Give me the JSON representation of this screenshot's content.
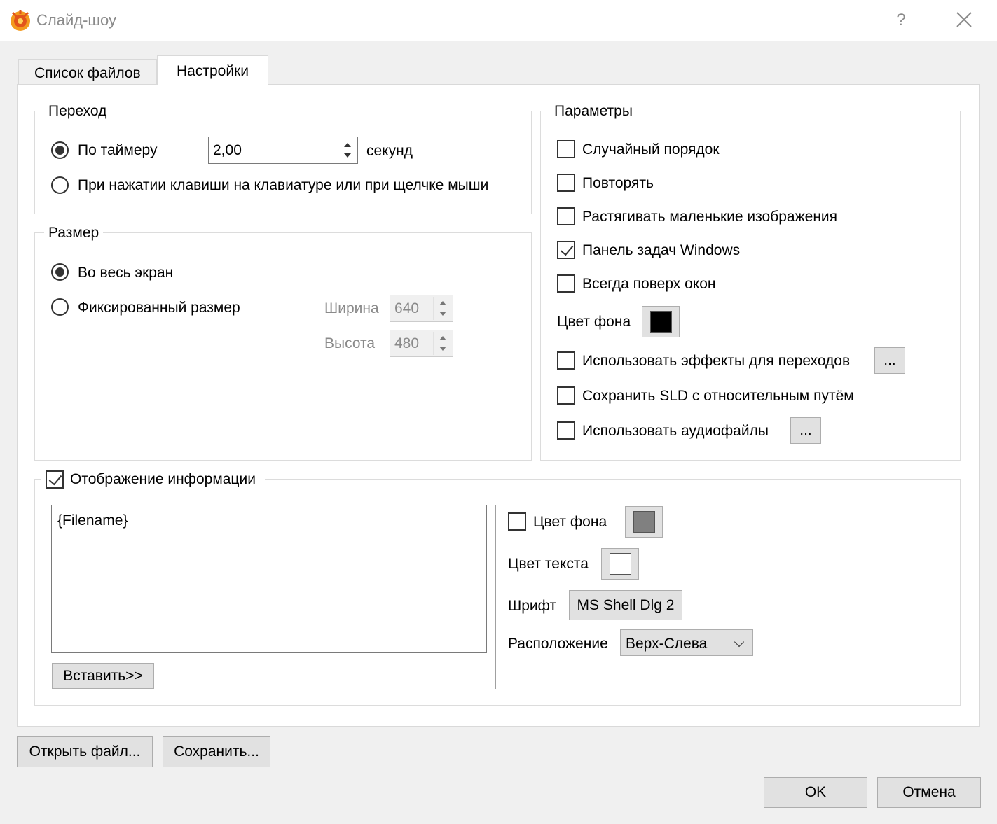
{
  "window": {
    "title": "Слайд-шоу",
    "help_label": "?",
    "icon": "xnview-app-icon"
  },
  "tabs": [
    {
      "label": "Список файлов",
      "active": false
    },
    {
      "label": "Настройки",
      "active": true
    }
  ],
  "transition": {
    "legend": "Переход",
    "timer_label": "По таймеру",
    "timer_selected": true,
    "timer_value": "2,00",
    "timer_unit": "секунд",
    "key_label": "При нажатии клавиши на клавиатуре или при щелчке мыши",
    "key_selected": false
  },
  "size": {
    "legend": "Размер",
    "fullscreen_label": "Во весь экран",
    "fullscreen_selected": true,
    "fixed_label": "Фиксированный размер",
    "fixed_selected": false,
    "width_label": "Ширина",
    "width_value": "640",
    "height_label": "Высота",
    "height_value": "480"
  },
  "params": {
    "legend": "Параметры",
    "random_label": "Случайный порядок",
    "random_checked": false,
    "repeat_label": "Повторять",
    "repeat_checked": false,
    "stretch_label": "Растягивать маленькие изображения",
    "stretch_checked": false,
    "taskbar_label": "Панель задач Windows",
    "taskbar_checked": true,
    "ontop_label": "Всегда поверх окон",
    "ontop_checked": false,
    "bg_color_label": "Цвет фона",
    "bg_color": "#000000",
    "effects_label": "Использовать эффекты для переходов",
    "effects_checked": false,
    "effects_button": "...",
    "relative_label": "Сохранить SLD с относительным путём",
    "relative_checked": false,
    "audio_label": "Использовать аудиофайлы",
    "audio_checked": false,
    "audio_button": "..."
  },
  "info": {
    "legend": "Отображение информации",
    "checked": true,
    "text": "{Filename}",
    "insert_button": "Вставить>>",
    "bg_label": "Цвет фона",
    "bg_checked": false,
    "bg_color": "#808080",
    "text_color_label": "Цвет текста",
    "text_color": "#ffffff",
    "font_label": "Шрифт",
    "font_button": "MS Shell Dlg 2",
    "position_label": "Расположение",
    "position_value": "Верх-Слева"
  },
  "footer": {
    "open_button": "Открыть файл...",
    "save_button": "Сохранить...",
    "ok_button": "OK",
    "cancel_button": "Отмена"
  }
}
